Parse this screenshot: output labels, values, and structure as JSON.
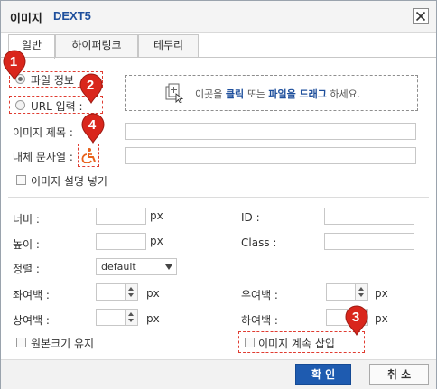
{
  "dialog": {
    "title": "이미지",
    "product": "DEXT5",
    "close_icon": "close-icon"
  },
  "tabs": [
    {
      "label": "일반",
      "active": true
    },
    {
      "label": "하이퍼링크",
      "active": false
    },
    {
      "label": "테두리",
      "active": false
    }
  ],
  "source": {
    "file_info_label": "파일 정보",
    "url_label": "URL 입력 :",
    "dropzone": {
      "prefix": "이곳을 ",
      "click": "클릭",
      "middle": " 또는 ",
      "drag": "파일을 드래그",
      "suffix": " 하세요.",
      "icon": "image-upload-icon"
    }
  },
  "fields": {
    "image_title_label": "이미지 제목 :",
    "alt_text_label": "대체 문자열 :",
    "alt_icon": "accessibility-icon",
    "add_caption_label": "이미지 설명 넣기"
  },
  "layout": {
    "width_label": "너비 :",
    "height_label": "높이 :",
    "unit": "px",
    "id_label": "ID :",
    "class_label": "Class :",
    "align_label": "정렬 :",
    "align_value": "default",
    "left_margin_label": "좌여백 :",
    "right_margin_label": "우여백 :",
    "top_margin_label": "상여백 :",
    "bottom_margin_label": "하여백 :",
    "keep_size_label": "원본크기 유지",
    "keep_insert_label": "이미지 계속 삽입"
  },
  "markers": [
    "1",
    "2",
    "3",
    "4"
  ],
  "buttons": {
    "ok": "확 인",
    "cancel": "취 소"
  },
  "colors": {
    "accent": "#1e5bb0",
    "marker": "#d9261c",
    "highlight_box": "#e03c31"
  }
}
